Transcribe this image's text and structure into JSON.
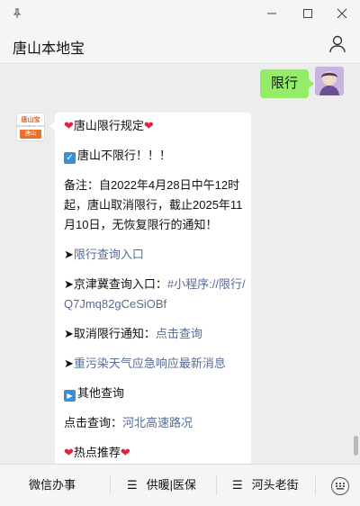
{
  "window": {
    "pin_icon": "pin-icon",
    "minimize_icon": "minimize-icon",
    "maximize_icon": "maximize-icon",
    "close_icon": "close-icon"
  },
  "header": {
    "title": "唐山本地宝",
    "user_icon": "person-icon"
  },
  "chat": {
    "user_message": "限行",
    "bot_avatar": {
      "line1": "唐山宝",
      "line2": "ts.bendibao.com",
      "line3": "唐山"
    },
    "lines": {
      "l1_text": "唐山限行规定",
      "l2_text": "唐山不限行！！！",
      "l3_a": "备注：自2022年4月28日中午12时",
      "l3_b": "起，唐山取消限行，截止2025年11",
      "l3_c": "月10日，无恢复限行的通知！",
      "l4_link": "限行查询入口",
      "l5_text": "京津冀查询入口：",
      "l5_link_a": "#小程序://限行/",
      "l5_link_b": "Q7Jmq82gCeSiOBf",
      "l6_text": "取消限行通知：",
      "l6_link": "点击查询",
      "l7_link": "重污染天气应急响应最新消息",
      "l8_text": "其他查询",
      "l9_text": "点击查询：",
      "l9_link": "河北高速路况",
      "l10_text": "热点推荐"
    }
  },
  "menubar": {
    "item1": "微信办事",
    "item2": "供暖|医保",
    "item3": "河头老街",
    "menu_icon": "menu-lines-icon",
    "keyboard_icon": "keyboard-icon"
  },
  "colors": {
    "link": "#576b95",
    "self_bubble": "#95ec69",
    "heart": "#e0243a",
    "accent_blue": "#3b8fd8"
  }
}
